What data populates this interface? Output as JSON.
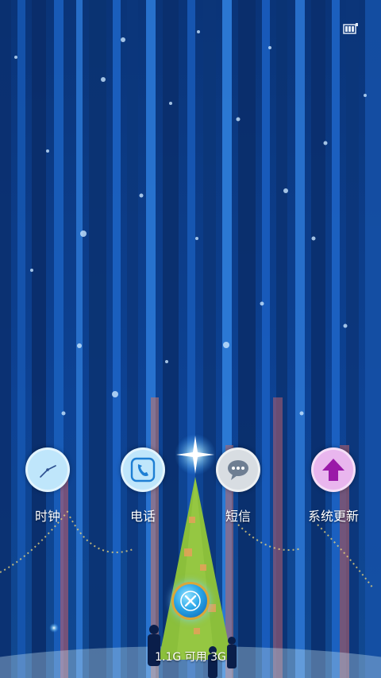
{
  "status_bar": {
    "icon": "battery-icon"
  },
  "apps": [
    {
      "label": "时钟",
      "icon": "clock-icon",
      "color": "#bfe6fb"
    },
    {
      "label": "电话",
      "icon": "phone-icon",
      "color": "#bfe6fb"
    },
    {
      "label": "短信",
      "icon": "message-icon",
      "color": "#d8dde2"
    },
    {
      "label": "系统更新",
      "icon": "update-arrow-icon",
      "color": "#e9b6ee"
    }
  ],
  "close_button": {
    "icon": "close-icon",
    "ring_color": "#d9a73a"
  },
  "memory": {
    "text": "1.1G 可用  3G"
  },
  "colors": {
    "background": "#0d3d86",
    "accent": "#9a1aa8"
  }
}
